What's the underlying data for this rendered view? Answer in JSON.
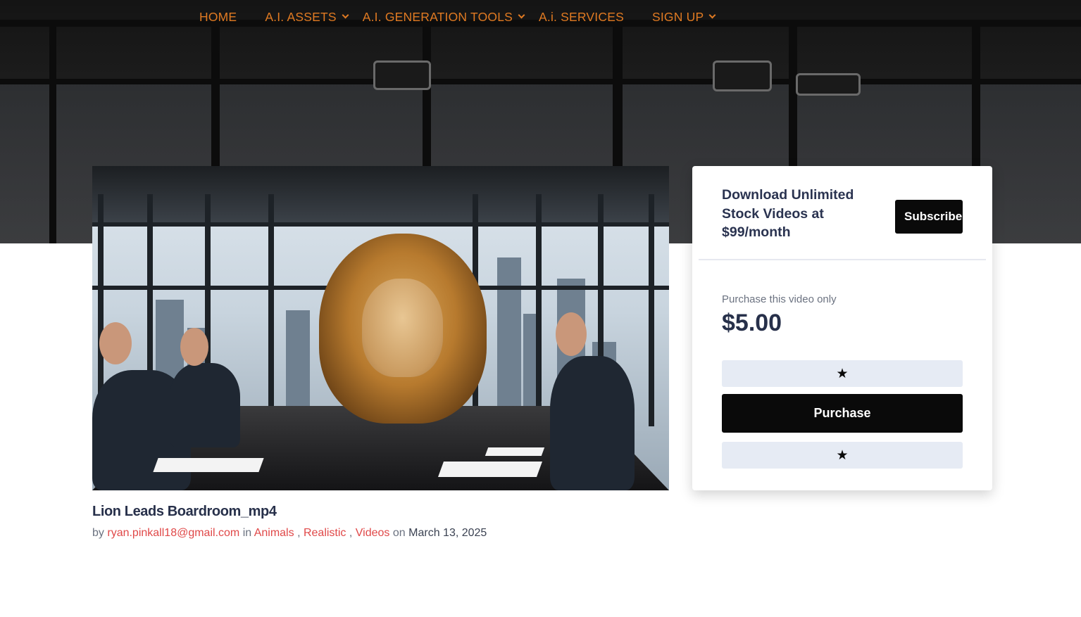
{
  "nav": {
    "items": [
      {
        "label": "HOME",
        "has_dropdown": false
      },
      {
        "label": "A.I. ASSETS",
        "has_dropdown": true
      },
      {
        "label": "A.I. GENERATION TOOLS",
        "has_dropdown": true
      },
      {
        "label": "A.i. SERVICES",
        "has_dropdown": false
      },
      {
        "label": "SIGN UP",
        "has_dropdown": true
      }
    ],
    "color": "#e07a22"
  },
  "video": {
    "title": "Lion Leads Boardroom_mp4",
    "meta": {
      "by_label": "by",
      "author": "ryan.pinkall18@gmail.com",
      "in_label": "in",
      "categories": [
        "Animals",
        "Realistic",
        "Videos"
      ],
      "separator": ",",
      "on_label": "on",
      "date": "March 13, 2025"
    },
    "thumbnail_icon": "lion-boardroom-image"
  },
  "sidebar": {
    "promo_text": "Download Unlimited Stock Videos at $99/month",
    "subscribe_label": "Subscribe",
    "purchase_label_small": "Purchase this video only",
    "price": "$5.00",
    "star_button_top": "★",
    "purchase_button": "Purchase",
    "star_button_bottom": "★"
  },
  "colors": {
    "accent_link": "#e04848",
    "heading": "#27304a",
    "button_dark": "#0a0a0a",
    "button_light": "#e6ebf4"
  }
}
